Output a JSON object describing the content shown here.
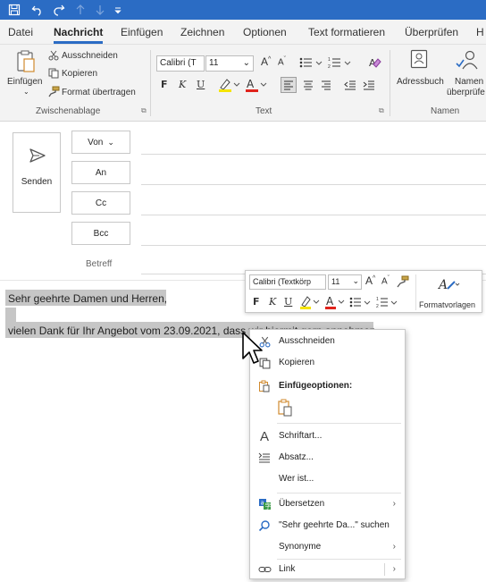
{
  "tabs": [
    "Datei",
    "Nachricht",
    "Einfügen",
    "Zeichnen",
    "Optionen",
    "Text formatieren",
    "Überprüfen",
    "H"
  ],
  "ribbon": {
    "paste_label": "Einfügen",
    "cut_label": "Ausschneiden",
    "copy_label": "Kopieren",
    "format_painter_label": "Format übertragen",
    "clipboard_group": "Zwischenablage",
    "font_name": "Calibri (T",
    "font_size": "11",
    "bold": "F",
    "italic": "K",
    "underline": "U",
    "text_group": "Text",
    "addressbook_label": "Adressbuch",
    "names_label_1": "Namen",
    "names_label_2": "überprüfe",
    "names_group": "Namen",
    "highlight_color": "#f5e400",
    "font_color": "#e0231c"
  },
  "header": {
    "send_label": "Senden",
    "from_label": "Von",
    "to_label": "An",
    "cc_label": "Cc",
    "bcc_label": "Bcc",
    "subject_label": "Betreff"
  },
  "body": {
    "line1": "Sehr geehrte Damen und Herren,",
    "line2": "vielen Dank für Ihr Angebot vom 23.09.2021, dass wir hiermit gern annehmen"
  },
  "mini_toolbar": {
    "font_name": "Calibri (Textkörp",
    "font_size": "11",
    "bold": "F",
    "italic": "K",
    "underline": "U",
    "styles_label": "Formatvorlagen"
  },
  "context_menu": {
    "cut": "Ausschneiden",
    "copy": "Kopieren",
    "paste_options": "Einfügeoptionen:",
    "font": "Schriftart...",
    "paragraph": "Absatz...",
    "who_is": "Wer ist...",
    "translate": "Übersetzen",
    "search": "\"Sehr geehrte Da...\" suchen",
    "synonyms": "Synonyme",
    "link": "Link"
  },
  "colors": {
    "accent": "#2b6cc4",
    "selection": "#c6c6c6",
    "ribbon_bg": "#f3f3f3"
  }
}
